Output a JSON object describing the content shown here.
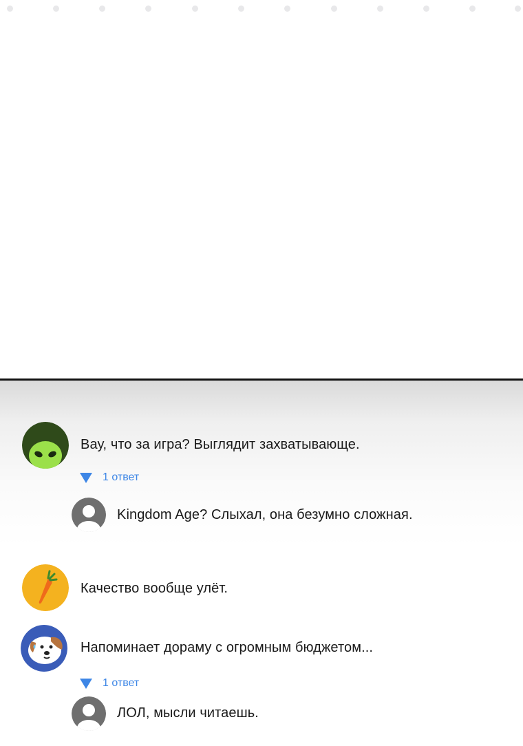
{
  "colors": {
    "accent_blue": "#3d86e6",
    "divider": "#111111",
    "text": "#1a1a1a",
    "avatar_alien_bg": "#2f4a1a",
    "avatar_carrot_bg": "#f4b21f",
    "avatar_dog_bg": "#3a5cb8",
    "avatar_default_bg": "#6f6f6f"
  },
  "comments": [
    {
      "avatar_icon": "alien-avatar",
      "text": "Вау, что за игра? Выглядит захватывающе.",
      "replies_label": "1 ответ",
      "reply": {
        "avatar_icon": "default-user-avatar",
        "text": "Kingdom Age? Слыхал, она безумно сложная."
      }
    },
    {
      "avatar_icon": "carrot-avatar",
      "text": "Качество вообще улёт."
    },
    {
      "avatar_icon": "dog-avatar",
      "text": "Напоминает дораму с огромным бюджетом...",
      "replies_label": "1 ответ",
      "reply": {
        "avatar_icon": "default-user-avatar",
        "text": "ЛОЛ, мысли читаешь."
      }
    }
  ]
}
